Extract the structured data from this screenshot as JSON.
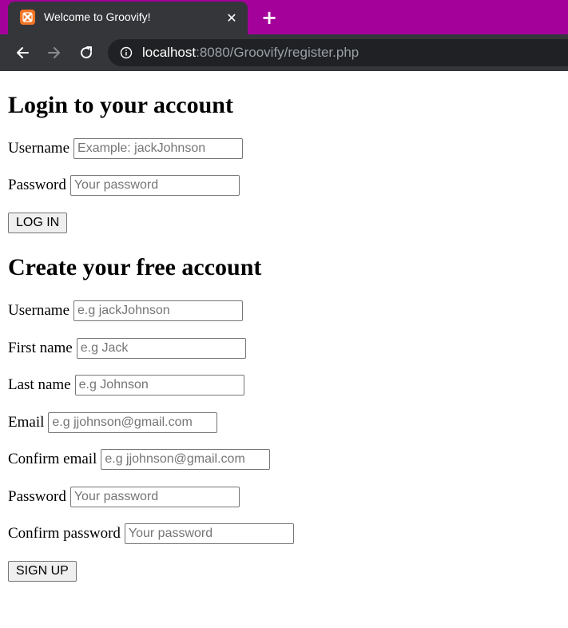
{
  "browser": {
    "tab_title": "Welcome to Groovify!",
    "url_host": "localhost",
    "url_rest": ":8080/Groovify/register.php",
    "accent_color": "#a4009a"
  },
  "login": {
    "heading": "Login to your account",
    "username_label": "Username",
    "username_placeholder": "Example: jackJohnson",
    "password_label": "Password",
    "password_placeholder": "Your password",
    "button_label": "LOG IN"
  },
  "register": {
    "heading": "Create your free account",
    "username_label": "Username",
    "username_placeholder": "e.g jackJohnson",
    "first_name_label": "First name",
    "first_name_placeholder": "e.g Jack",
    "last_name_label": "Last name",
    "last_name_placeholder": "e.g Johnson",
    "email_label": "Email",
    "email_placeholder": "e.g jjohnson@gmail.com",
    "confirm_email_label": "Confirm email",
    "confirm_email_placeholder": "e.g jjohnson@gmail.com",
    "password_label": "Password",
    "password_placeholder": "Your password",
    "confirm_password_label": "Confirm password",
    "confirm_password_placeholder": "Your password",
    "button_label": "SIGN UP"
  }
}
